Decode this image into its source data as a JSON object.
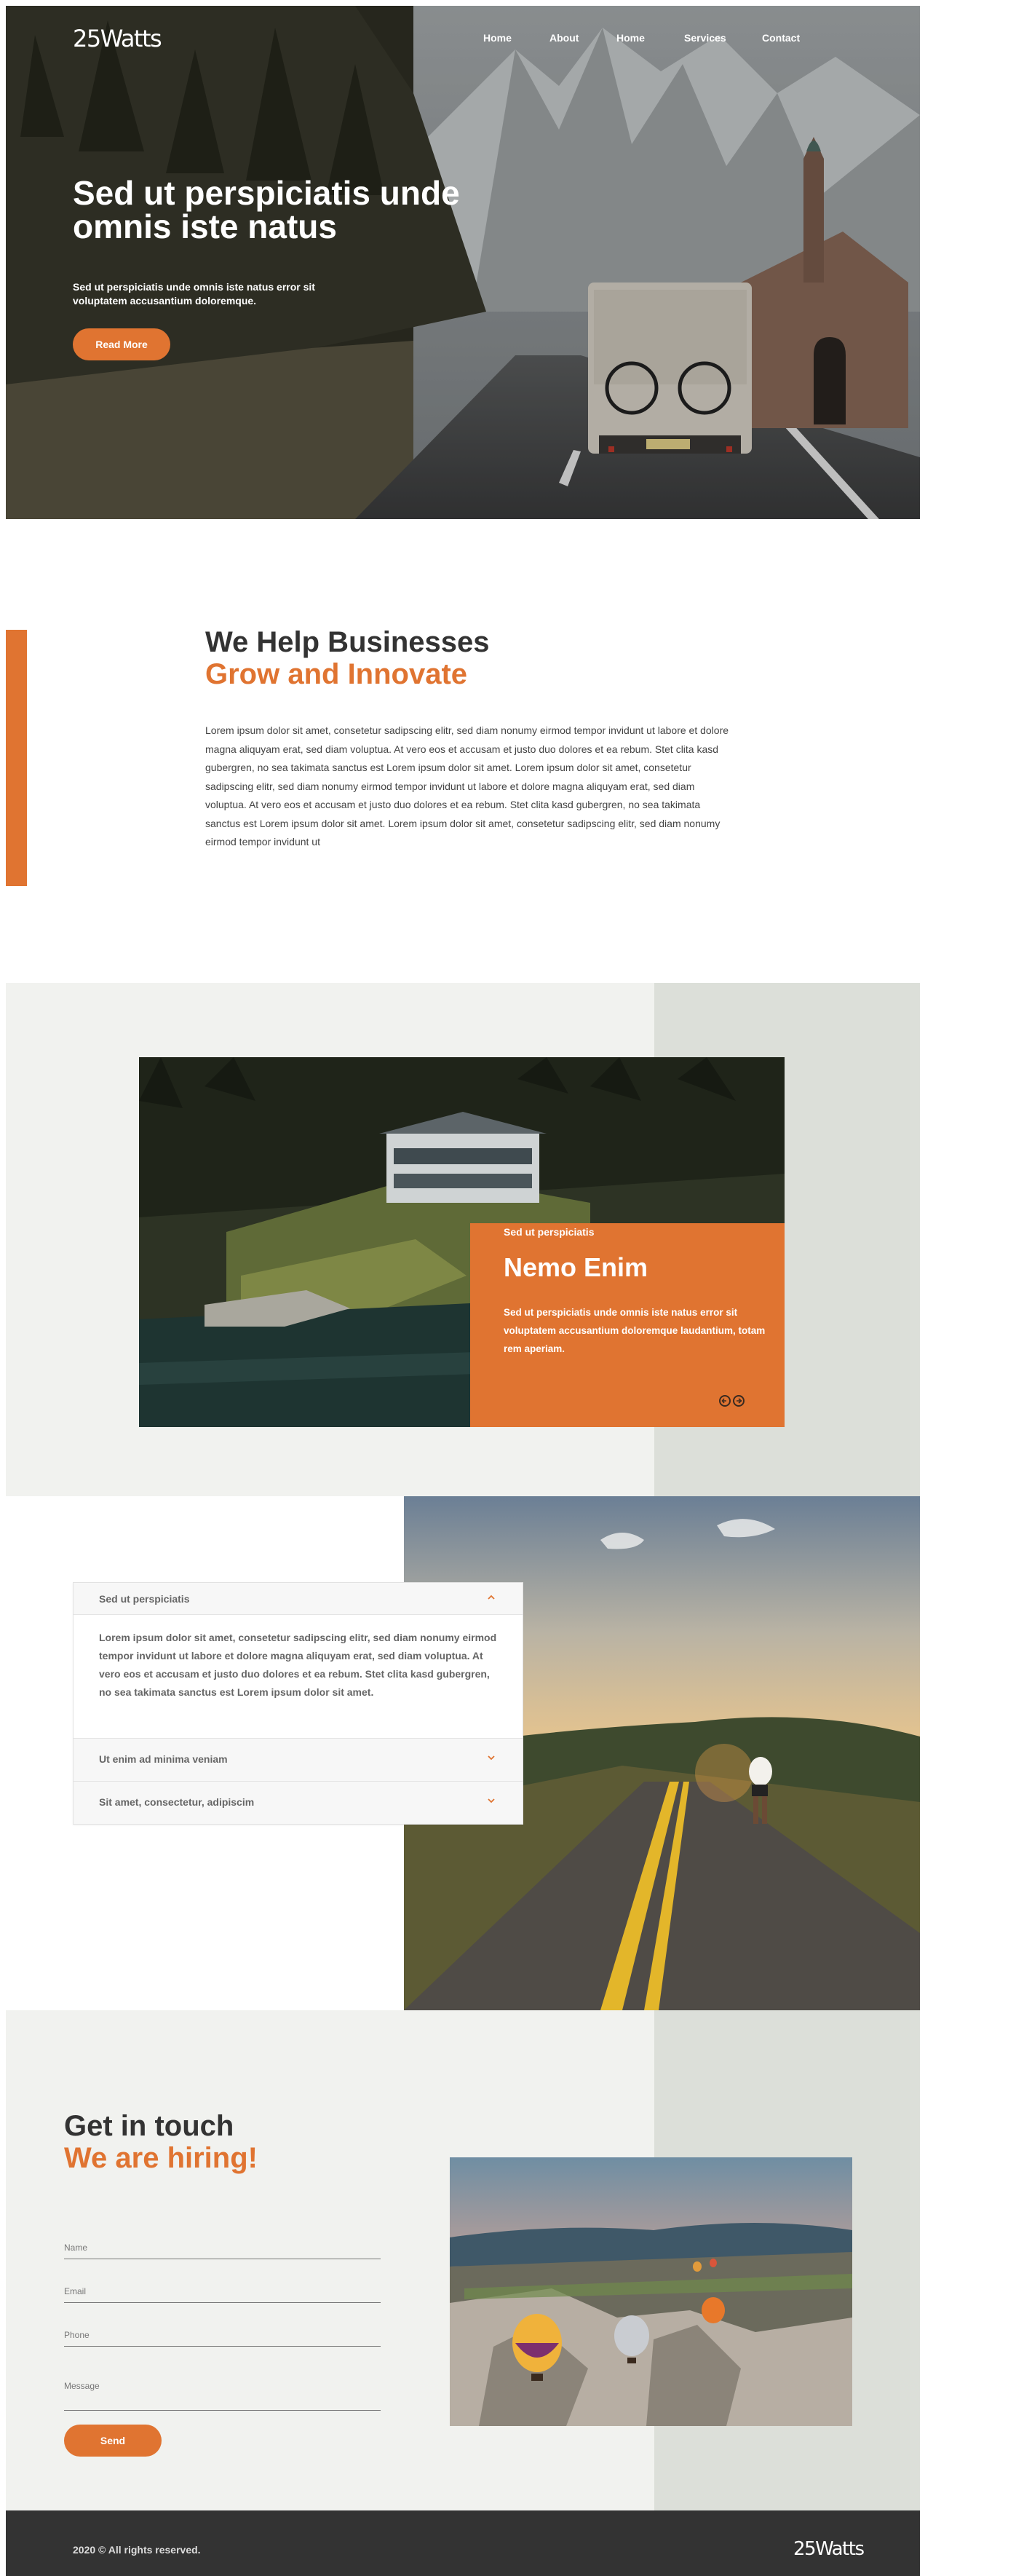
{
  "brand": {
    "logo_text": "25Watts",
    "accent_color": "#e07431",
    "dark_color": "#333333"
  },
  "nav": {
    "items": [
      "Home",
      "About",
      "Home",
      "Services",
      "Contact"
    ]
  },
  "hero": {
    "title": "Sed ut perspiciatis unde omnis iste natus",
    "subtitle": "Sed ut perspiciatis unde omnis iste natus error sit voluptatem accusantium doloremque.",
    "cta_label": "Read More"
  },
  "about": {
    "title_line1": "We Help Businesses",
    "title_line2": "Grow and Innovate",
    "body": "Lorem ipsum dolor sit amet, consetetur sadipscing elitr, sed diam nonumy eirmod tempor invidunt ut labore et dolore magna aliquyam erat, sed diam voluptua. At vero eos et accusam et justo duo dolores et ea rebum. Stet clita kasd gubergren, no sea takimata sanctus est Lorem ipsum dolor sit amet. Lorem ipsum dolor sit amet, consetetur sadipscing elitr, sed diam nonumy eirmod tempor invidunt ut labore et dolore magna aliquyam erat, sed diam voluptua. At vero eos et accusam et justo duo dolores et ea rebum. Stet clita kasd gubergren, no sea takimata sanctus est Lorem ipsum dolor sit amet. Lorem ipsum dolor sit amet, consetetur sadipscing elitr, sed diam nonumy eirmod tempor invidunt ut"
  },
  "feature": {
    "kicker": "Sed ut perspiciatis",
    "title": "Nemo Enim",
    "text": "Sed ut perspiciatis unde omnis iste natus error sit voluptatem accusantium doloremque laudantium, totam rem aperiam.",
    "prev_icon": "arrow-left-circle-icon",
    "next_icon": "arrow-right-circle-icon"
  },
  "faq": {
    "items": [
      {
        "question": "Sed ut perspiciatis",
        "answer": "Lorem ipsum dolor sit amet, consetetur sadipscing elitr, sed diam nonumy eirmod tempor invidunt ut labore et dolore magna aliquyam erat, sed diam voluptua. At vero eos et accusam et justo duo dolores et ea rebum. Stet clita kasd gubergren, no sea takimata sanctus est Lorem ipsum dolor sit amet.",
        "expanded": true
      },
      {
        "question": "Ut enim ad minima veniam",
        "expanded": false
      },
      {
        "question": "Sit amet, consectetur, adipiscim",
        "expanded": false
      }
    ]
  },
  "contact": {
    "title_line1": "Get in touch",
    "title_line2": "We are hiring!",
    "fields": {
      "name_placeholder": "Name",
      "email_placeholder": "Email",
      "phone_placeholder": "Phone",
      "message_placeholder": "Message"
    },
    "send_label": "Send"
  },
  "footer": {
    "copyright": "2020 © All rights reserved.",
    "logo_text": "25Watts"
  }
}
